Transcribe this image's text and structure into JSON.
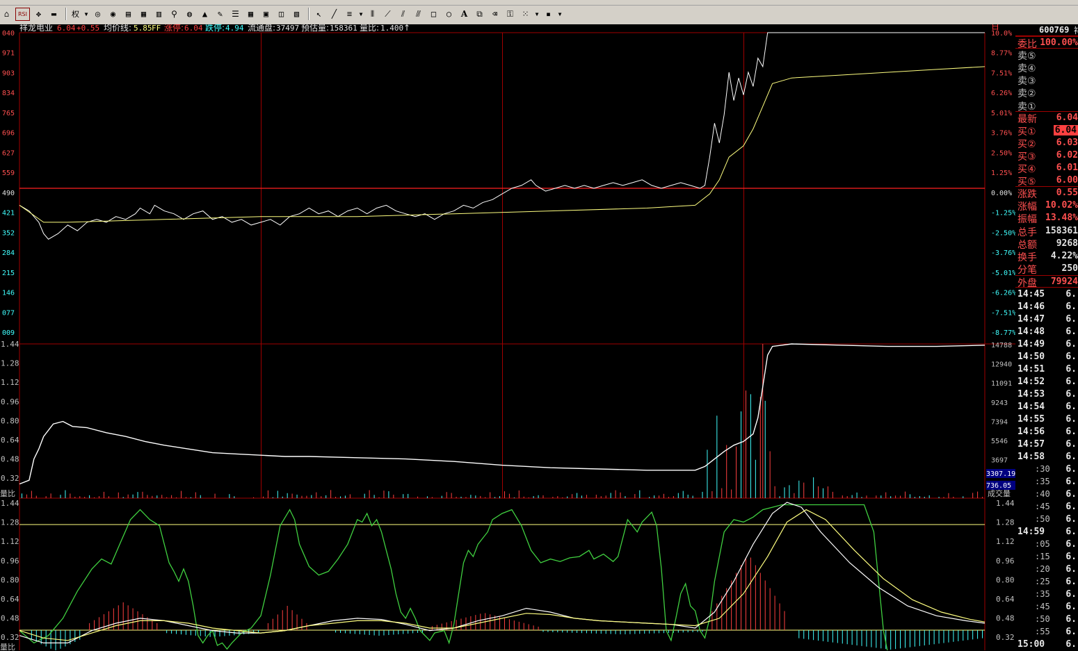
{
  "toolbar": {
    "rights_label": "权",
    "rsi_label": "RSI"
  },
  "header": {
    "name": "祥龙电业",
    "price": "6.04",
    "change": "+0.55",
    "avg_label": "均价线:",
    "avg_value": "5.85",
    "avg_suffix": "FF",
    "limit_up_label": "涨停:",
    "limit_up_value": "6.04",
    "limit_down_label": "跌停:",
    "limit_down_value": "4.94",
    "float_label": "流通盘:",
    "float_value": "37497",
    "est_vol_label": "预估量:",
    "est_vol_value": "158361",
    "vol_ratio_label": "量比:",
    "vol_ratio_value": "1.400",
    "vol_ratio_arrow": "↑"
  },
  "price_panel": {
    "left_ticks": [
      "040",
      "971",
      "903",
      "834",
      "765",
      "696",
      "627",
      "559",
      "490",
      "421",
      "352",
      "284",
      "215",
      "146",
      "077",
      "009"
    ],
    "right_ticks": [
      "10.0%",
      "8.77%",
      "7.51%",
      "6.26%",
      "5.01%",
      "3.76%",
      "2.50%",
      "1.25%",
      "0.00%",
      "-1.25%",
      "-2.50%",
      "-3.76%",
      "-5.01%",
      "-6.26%",
      "-7.51%",
      "-8.77%"
    ],
    "corner_mark": "日"
  },
  "volume_panel": {
    "left_ticks": [
      "1.44",
      "1.28",
      "1.12",
      "0.96",
      "0.80",
      "0.64",
      "0.48",
      "0.32"
    ],
    "right_ticks": [
      "14788",
      "12940",
      "11091",
      "9243",
      "7394",
      "5546",
      "3697"
    ],
    "box_top": "3307.19",
    "box_bottom": "736.05",
    "bottom_left_label": "量比",
    "bottom_right_label": "成交量"
  },
  "indicator_panel": {
    "left_ticks": [
      "1.44",
      "1.28",
      "1.12",
      "0.96",
      "0.80",
      "0.64",
      "0.48",
      "0.32"
    ],
    "right_ticks": [
      "1.44",
      "1.28",
      "1.12",
      "0.96",
      "0.80",
      "0.64",
      "0.48",
      "0.32"
    ],
    "bottom_left_label": "量比"
  },
  "sidebar": {
    "code": "600769",
    "code_suffix": "祥",
    "rows": [
      {
        "label": "委比",
        "value": "100.00%",
        "boxed": true
      },
      {
        "label": "卖⑤",
        "value": ""
      },
      {
        "label": "卖④",
        "value": ""
      },
      {
        "label": "卖③",
        "value": ""
      },
      {
        "label": "卖②",
        "value": ""
      },
      {
        "label": "卖①",
        "value": ""
      },
      {
        "label": "最新",
        "value": "6.04"
      },
      {
        "label": "买①",
        "value": "6.04",
        "highlight": true
      },
      {
        "label": "买②",
        "value": "6.03"
      },
      {
        "label": "买③",
        "value": "6.02"
      },
      {
        "label": "买④",
        "value": "6.01"
      },
      {
        "label": "买⑤",
        "value": "6.00"
      },
      {
        "label": "涨跌",
        "value": "0.55"
      },
      {
        "label": "涨幅",
        "value": "10.02%"
      },
      {
        "label": "振幅",
        "value": "13.48%"
      },
      {
        "label": "总手",
        "value": "158361"
      },
      {
        "label": "总额",
        "value": "9268"
      },
      {
        "label": "换手",
        "value": "4.22%"
      },
      {
        "label": "分笔",
        "value": "250"
      },
      {
        "label": "外盘",
        "value": "79924",
        "boxed": true
      }
    ],
    "ticks": [
      {
        "time": "14:45",
        "price": "6."
      },
      {
        "time": "14:46",
        "price": "6."
      },
      {
        "time": "14:47",
        "price": "6."
      },
      {
        "time": "14:48",
        "price": "6."
      },
      {
        "time": "14:49",
        "price": "6."
      },
      {
        "time": "14:50",
        "price": "6."
      },
      {
        "time": "14:51",
        "price": "6."
      },
      {
        "time": "14:52",
        "price": "6."
      },
      {
        "time": "14:53",
        "price": "6."
      },
      {
        "time": "14:54",
        "price": "6."
      },
      {
        "time": "14:55",
        "price": "6."
      },
      {
        "time": "14:56",
        "price": "6."
      },
      {
        "time": "14:57",
        "price": "6."
      },
      {
        "time": "14:58",
        "price": "6."
      },
      {
        "time": ":30",
        "price": "6.",
        "sub": true
      },
      {
        "time": ":35",
        "price": "6.",
        "sub": true
      },
      {
        "time": ":40",
        "price": "6.",
        "sub": true
      },
      {
        "time": ":45",
        "price": "6.",
        "sub": true
      },
      {
        "time": ":50",
        "price": "6.",
        "sub": true
      },
      {
        "time": "14:59",
        "price": "6."
      },
      {
        "time": ":05",
        "price": "6.",
        "sub": true
      },
      {
        "time": ":15",
        "price": "6.",
        "sub": true
      },
      {
        "time": ":20",
        "price": "6.",
        "sub": true
      },
      {
        "time": ":25",
        "price": "6.",
        "sub": true
      },
      {
        "time": ":35",
        "price": "6.",
        "sub": true
      },
      {
        "time": ":45",
        "price": "6.",
        "sub": true
      },
      {
        "time": ":50",
        "price": "6.",
        "sub": true
      },
      {
        "time": ":55",
        "price": "6.",
        "sub": true
      },
      {
        "time": "15:00",
        "price": "6."
      }
    ]
  },
  "colors": {
    "grid_red": "#a00000",
    "price_line": "#ffffff",
    "avg_line": "#ffff80",
    "up_red": "#ff4040",
    "down_cyan": "#40ffff",
    "green_line": "#40d040",
    "text_gray": "#c0c0c0"
  },
  "chart_data": {
    "type": "line",
    "price_series": [
      [
        0,
        5.43
      ],
      [
        4,
        5.41
      ],
      [
        8,
        5.37
      ],
      [
        10,
        5.33
      ],
      [
        12,
        5.31
      ],
      [
        16,
        5.33
      ],
      [
        20,
        5.36
      ],
      [
        24,
        5.34
      ],
      [
        28,
        5.37
      ],
      [
        32,
        5.38
      ],
      [
        36,
        5.37
      ],
      [
        40,
        5.39
      ],
      [
        44,
        5.38
      ],
      [
        48,
        5.4
      ],
      [
        50,
        5.42
      ],
      [
        54,
        5.4
      ],
      [
        56,
        5.43
      ],
      [
        60,
        5.41
      ],
      [
        64,
        5.4
      ],
      [
        68,
        5.38
      ],
      [
        72,
        5.4
      ],
      [
        76,
        5.41
      ],
      [
        80,
        5.38
      ],
      [
        84,
        5.39
      ],
      [
        88,
        5.37
      ],
      [
        92,
        5.38
      ],
      [
        96,
        5.36
      ],
      [
        100,
        5.37
      ],
      [
        104,
        5.38
      ],
      [
        108,
        5.36
      ],
      [
        112,
        5.39
      ],
      [
        116,
        5.4
      ],
      [
        120,
        5.42
      ],
      [
        124,
        5.4
      ],
      [
        128,
        5.41
      ],
      [
        132,
        5.39
      ],
      [
        136,
        5.41
      ],
      [
        140,
        5.42
      ],
      [
        144,
        5.4
      ],
      [
        148,
        5.42
      ],
      [
        152,
        5.43
      ],
      [
        156,
        5.41
      ],
      [
        160,
        5.4
      ],
      [
        164,
        5.39
      ],
      [
        168,
        5.4
      ],
      [
        172,
        5.38
      ],
      [
        176,
        5.4
      ],
      [
        180,
        5.41
      ],
      [
        184,
        5.43
      ],
      [
        188,
        5.42
      ],
      [
        192,
        5.44
      ],
      [
        196,
        5.45
      ],
      [
        200,
        5.47
      ],
      [
        204,
        5.49
      ],
      [
        208,
        5.5
      ],
      [
        212,
        5.52
      ],
      [
        214,
        5.5
      ],
      [
        218,
        5.48
      ],
      [
        222,
        5.49
      ],
      [
        226,
        5.5
      ],
      [
        230,
        5.49
      ],
      [
        234,
        5.5
      ],
      [
        238,
        5.49
      ],
      [
        242,
        5.5
      ],
      [
        246,
        5.51
      ],
      [
        250,
        5.5
      ],
      [
        254,
        5.51
      ],
      [
        258,
        5.52
      ],
      [
        262,
        5.5
      ],
      [
        266,
        5.49
      ],
      [
        270,
        5.5
      ],
      [
        274,
        5.51
      ],
      [
        278,
        5.5
      ],
      [
        282,
        5.49
      ],
      [
        284,
        5.5
      ],
      [
        286,
        5.6
      ],
      [
        288,
        5.72
      ],
      [
        290,
        5.65
      ],
      [
        292,
        5.75
      ],
      [
        294,
        5.9
      ],
      [
        296,
        5.8
      ],
      [
        298,
        5.88
      ],
      [
        300,
        5.82
      ],
      [
        302,
        5.9
      ],
      [
        304,
        5.85
      ],
      [
        306,
        5.95
      ],
      [
        308,
        5.92
      ],
      [
        310,
        6.04
      ],
      [
        330,
        6.04
      ],
      [
        360,
        6.04
      ],
      [
        400,
        6.04
      ]
    ],
    "avg_series": [
      [
        0,
        5.43
      ],
      [
        10,
        5.37
      ],
      [
        20,
        5.37
      ],
      [
        60,
        5.38
      ],
      [
        100,
        5.39
      ],
      [
        140,
        5.39
      ],
      [
        180,
        5.4
      ],
      [
        220,
        5.41
      ],
      [
        260,
        5.42
      ],
      [
        280,
        5.43
      ],
      [
        286,
        5.47
      ],
      [
        290,
        5.52
      ],
      [
        294,
        5.6
      ],
      [
        300,
        5.64
      ],
      [
        304,
        5.7
      ],
      [
        308,
        5.78
      ],
      [
        312,
        5.86
      ],
      [
        320,
        5.88
      ],
      [
        340,
        5.89
      ],
      [
        360,
        5.9
      ],
      [
        380,
        5.91
      ],
      [
        400,
        5.92
      ]
    ],
    "price_range": [
      4.94,
      6.04
    ],
    "prev_close": 5.49,
    "pct_range": [
      -10.0,
      10.0
    ],
    "volume_ratio_series": [
      [
        0,
        0.32
      ],
      [
        4,
        0.35
      ],
      [
        6,
        0.52
      ],
      [
        8,
        0.6
      ],
      [
        10,
        0.7
      ],
      [
        14,
        0.8
      ],
      [
        18,
        0.82
      ],
      [
        22,
        0.78
      ],
      [
        28,
        0.77
      ],
      [
        36,
        0.73
      ],
      [
        44,
        0.7
      ],
      [
        52,
        0.66
      ],
      [
        60,
        0.63
      ],
      [
        70,
        0.6
      ],
      [
        80,
        0.57
      ],
      [
        90,
        0.56
      ],
      [
        100,
        0.55
      ],
      [
        110,
        0.54
      ],
      [
        120,
        0.54
      ],
      [
        140,
        0.53
      ],
      [
        160,
        0.52
      ],
      [
        180,
        0.5
      ],
      [
        200,
        0.47
      ],
      [
        220,
        0.45
      ],
      [
        240,
        0.44
      ],
      [
        260,
        0.43
      ],
      [
        280,
        0.43
      ],
      [
        284,
        0.46
      ],
      [
        288,
        0.52
      ],
      [
        292,
        0.58
      ],
      [
        296,
        0.63
      ],
      [
        300,
        0.66
      ],
      [
        304,
        0.72
      ],
      [
        306,
        0.85
      ],
      [
        308,
        1.1
      ],
      [
        310,
        1.35
      ],
      [
        312,
        1.42
      ],
      [
        320,
        1.44
      ],
      [
        340,
        1.43
      ],
      [
        360,
        1.42
      ],
      [
        380,
        1.42
      ],
      [
        400,
        1.43
      ]
    ],
    "volume_ratio_range": [
      0.24,
      1.44
    ],
    "volume_max": 14788,
    "volume_bars_note": "minute volume bars, tall red/cyan bars after limit-up",
    "x_count": 400
  }
}
